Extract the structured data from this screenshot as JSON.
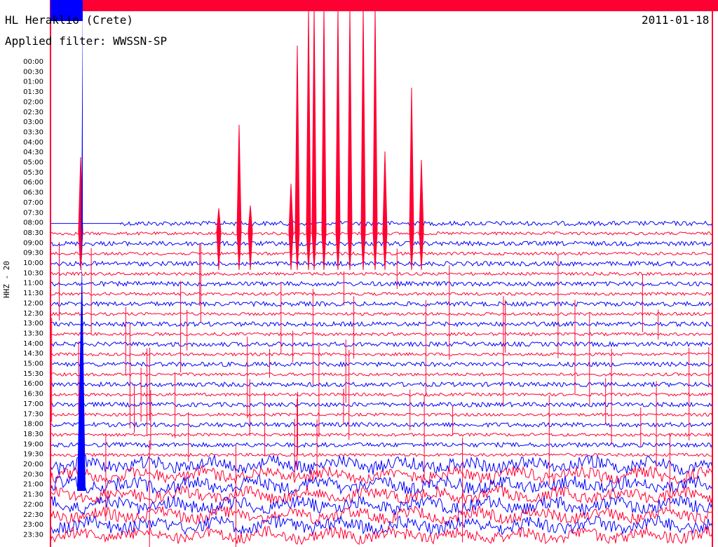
{
  "header": {
    "station": "HL Heraklio (Crete)",
    "date": "2011-01-18",
    "filter": "Applied filter: WWSSN-SP",
    "channel": "HHZ - 20"
  },
  "chart_data": {
    "type": "line",
    "title": "HL Heraklio (Crete)",
    "subtitle": "Applied filter: WWSSN-SP",
    "date": "2011-01-18",
    "ylabel": "HHZ - 20",
    "colors": {
      "trace_a": "#0000ff",
      "trace_b": "#ff0033",
      "background": "#ffffff"
    },
    "time_labels": [
      "00:00",
      "00:30",
      "01:00",
      "01:30",
      "02:00",
      "02:30",
      "03:00",
      "03:30",
      "04:00",
      "04:30",
      "05:00",
      "05:30",
      "06:00",
      "06:30",
      "07:00",
      "07:30",
      "08:00",
      "08:30",
      "09:00",
      "09:30",
      "10:00",
      "10:30",
      "11:00",
      "11:30",
      "12:00",
      "12:30",
      "13:00",
      "13:30",
      "14:00",
      "14:30",
      "15:00",
      "15:30",
      "16:00",
      "16:30",
      "17:00",
      "17:30",
      "18:00",
      "18:30",
      "19:00",
      "19:30",
      "20:00",
      "20:30",
      "21:00",
      "21:30",
      "22:00",
      "22:30",
      "23:00",
      "23:30"
    ],
    "first_trace_label": "08:00",
    "grid": false,
    "legend": "none"
  }
}
